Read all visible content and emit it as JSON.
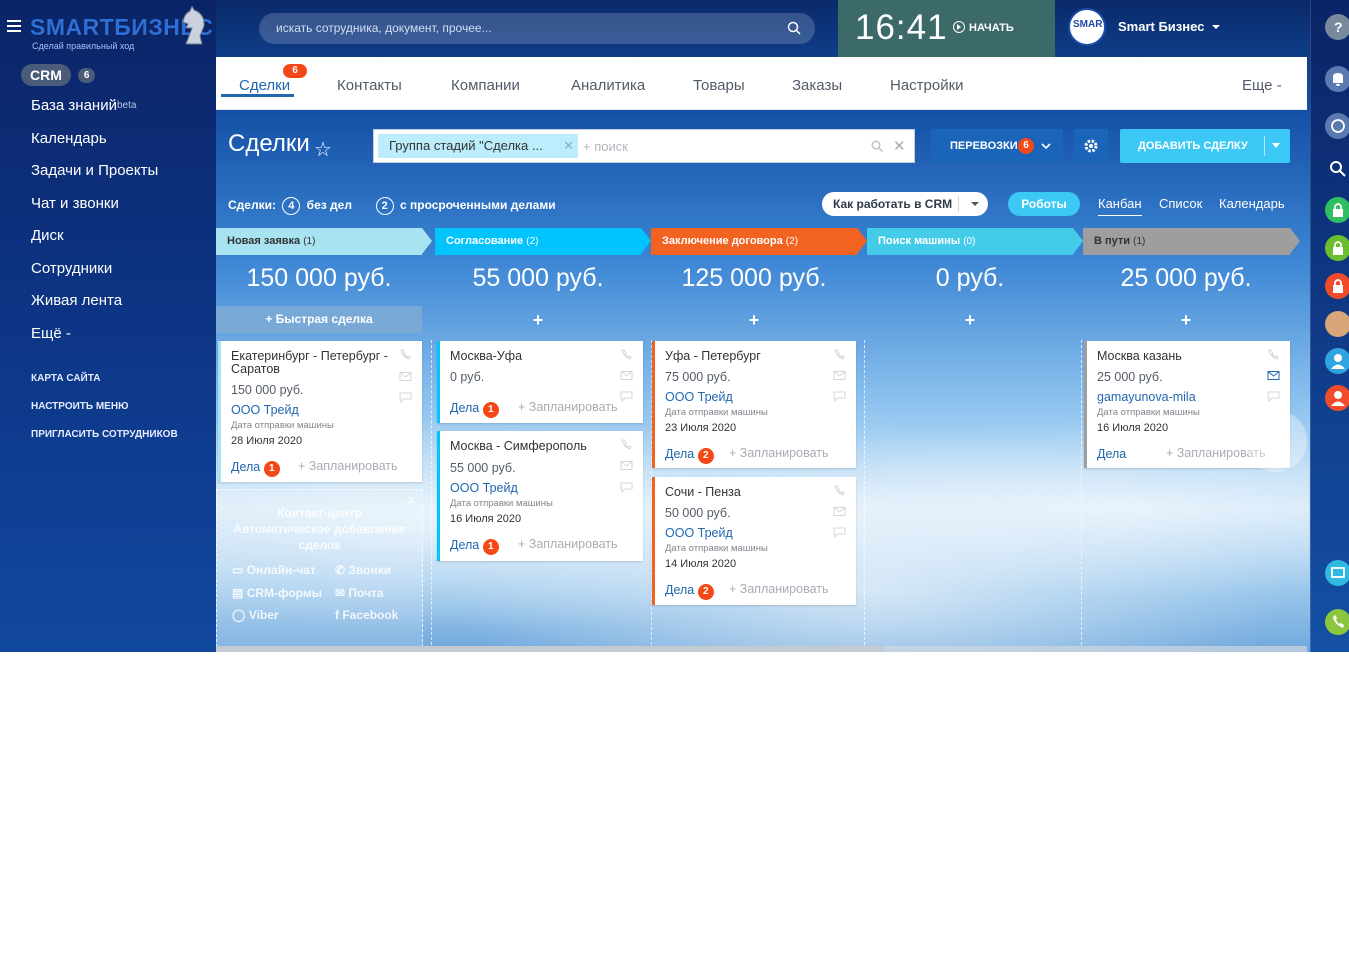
{
  "window": {
    "title": "Сделки"
  },
  "topbar": {
    "logo_main": "SMARTБИЗНЕС",
    "logo_tagline": "Сделай правильный ход",
    "search_placeholder": "искать сотрудника, документ, прочее...",
    "clock": "16:41",
    "start_label": "НАЧАТЬ",
    "user_name": "Smart Бизнес",
    "avatar_text": "SMART"
  },
  "sidebar": {
    "crm_label": "CRM",
    "crm_count": "6",
    "items": [
      {
        "label": "База знаний",
        "sup": "beta"
      },
      {
        "label": "Календарь"
      },
      {
        "label": "Задачи и Проекты"
      },
      {
        "label": "Чат и звонки"
      },
      {
        "label": "Диск"
      },
      {
        "label": "Сотрудники"
      },
      {
        "label": "Живая лента"
      },
      {
        "label": "Ещё -"
      }
    ],
    "small_links": [
      "КАРТА САЙТА",
      "НАСТРОИТЬ МЕНЮ",
      "ПРИГЛАСИТЬ СОТРУДНИКОВ"
    ]
  },
  "tabs": {
    "items": [
      "Сделки",
      "Контакты",
      "Компании",
      "Аналитика",
      "Товары",
      "Заказы",
      "Настройки"
    ],
    "deals_badge": "6",
    "more_label": "Еще -"
  },
  "header": {
    "title": "Сделки",
    "filter_chip": "Группа стадий \"Сделка ...",
    "filter_placeholder": "+ поиск",
    "category_label": "ПЕРЕВОЗКИ",
    "category_badge": "6",
    "add_label": "ДОБАВИТЬ СДЕЛКУ"
  },
  "stats": {
    "prefix": "Сделки:",
    "no_tasks_count": "4",
    "no_tasks_label": "без дел",
    "overdue_count": "2",
    "overdue_label": "с просроченными делами",
    "how_label": "Как работать в CRM",
    "robots_label": "Роботы",
    "views": [
      "Канбан",
      "Список",
      "Календарь"
    ]
  },
  "colors": {
    "stage1": "#a7e3f0",
    "stage2": "#00c4fb",
    "stage3": "#f26322",
    "stage4": "#44cbe9",
    "stage5": "#9e9e9e"
  },
  "columns": [
    {
      "name": "Новая заявка",
      "count": "(1)",
      "sum": "150 000 руб.",
      "quick": "+ Быстрая сделка"
    },
    {
      "name": "Согласование",
      "count": "(2)",
      "sum": "55 000 руб."
    },
    {
      "name": "Заключение договора",
      "count": "(2)",
      "sum": "125 000 руб."
    },
    {
      "name": "Поиск машины",
      "count": "(0)",
      "sum": "0 руб."
    },
    {
      "name": "В пути",
      "count": "(1)",
      "sum": "25 000 руб."
    }
  ],
  "cards": {
    "c1": {
      "title": "Екатеринбург - Петербург - Саратов",
      "sum": "150 000 руб.",
      "company": "ООО Трейд",
      "label": "Дата отправки машины",
      "date": "28 Июля 2020",
      "deals": "Дела",
      "badge": "1",
      "plan": "+ Запланировать"
    },
    "c2": {
      "title": "Москва-Уфа",
      "sum": "0 руб.",
      "deals": "Дела",
      "badge": "1",
      "plan": "+ Запланировать"
    },
    "c3": {
      "title": "Москва - Симферополь",
      "sum": "55 000 руб.",
      "company": "ООО Трейд",
      "label": "Дата отправки машины",
      "date": "16 Июля 2020",
      "deals": "Дела",
      "badge": "1",
      "plan": "+ Запланировать"
    },
    "c4": {
      "title": "Уфа - Петербург",
      "sum": "75 000 руб.",
      "company": "ООО Трейд",
      "label": "Дата отправки машины",
      "date": "23 Июля 2020",
      "deals": "Дела",
      "badge": "2",
      "plan": "+ Запланировать"
    },
    "c5": {
      "title": "Сочи - Пенза",
      "sum": "50 000 руб.",
      "company": "ООО Трейд",
      "label": "Дата отправки машины",
      "date": "14 Июля 2020",
      "deals": "Дела",
      "badge": "2",
      "plan": "+ Запланировать"
    },
    "c6": {
      "title": "Москва казань",
      "sum": "25 000 руб.",
      "company": "gamayunova-mila",
      "label": "Дата отправки машины",
      "date": "16 Июля 2020",
      "deals": "Дела",
      "plan": "+ Запланировать"
    }
  },
  "contact_center": {
    "title1": "Контакт-центр",
    "title2": "Автоматическое добавление сделок",
    "items": [
      "Онлайн-чат",
      "Звонки",
      "CRM-формы",
      "Почта",
      "Viber",
      "Facebook"
    ]
  }
}
